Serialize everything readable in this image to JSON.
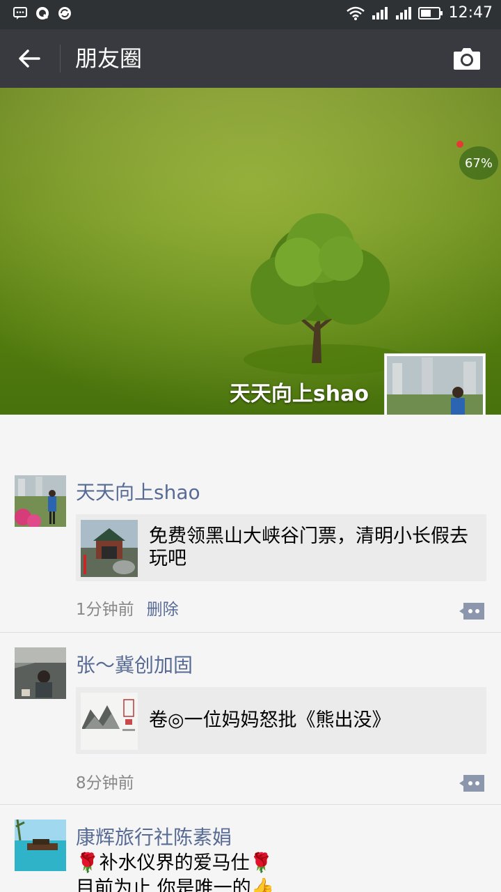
{
  "status_bar": {
    "time": "12:47"
  },
  "nav": {
    "title": "朋友圈"
  },
  "cover": {
    "name": "天天向上shao",
    "badge": "67%"
  },
  "posts": [
    {
      "author": "天天向上shao",
      "link_text": "免费领黑山大峡谷门票，清明小长假去玩吧",
      "time": "1分钟前",
      "delete_label": "删除"
    },
    {
      "author": "张～冀创加固",
      "link_text": "卷◎一位妈妈怒批《熊出没》",
      "time": "8分钟前"
    },
    {
      "author": "康辉旅行社陈素娟",
      "line1": "🌹补水仪界的爱马仕🌹",
      "line2": "目前为止 你是唯一的👍"
    }
  ],
  "colors": {
    "nav_bg": "#393a3f",
    "status_bg": "#2f3234",
    "name_blue": "#576b95"
  }
}
